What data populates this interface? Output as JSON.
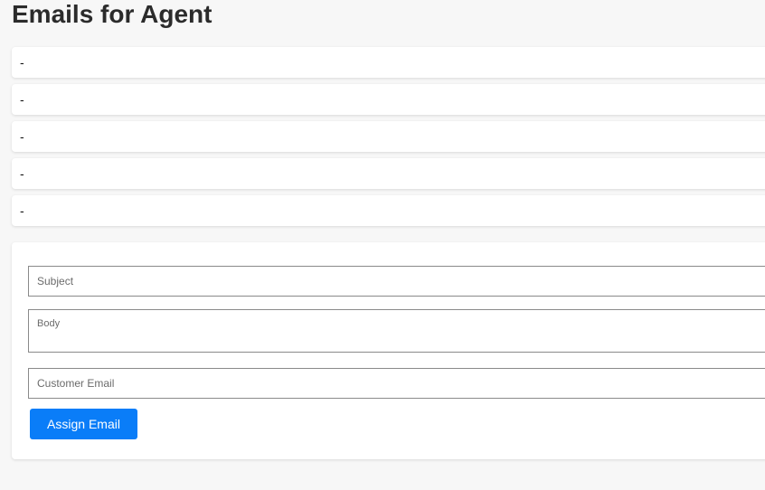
{
  "page": {
    "title": "Emails for Agent"
  },
  "emails": [
    {
      "text": "-"
    },
    {
      "text": "-"
    },
    {
      "text": "-"
    },
    {
      "text": "-"
    },
    {
      "text": "-"
    }
  ],
  "form": {
    "subject_placeholder": "Subject",
    "subject_value": "",
    "body_placeholder": "Body",
    "body_value": "",
    "customer_email_placeholder": "Customer Email",
    "customer_email_value": "",
    "assign_button_label": "Assign Email"
  },
  "colors": {
    "accent": "#0a7df8",
    "background": "#f7f7f7",
    "card": "#ffffff"
  }
}
